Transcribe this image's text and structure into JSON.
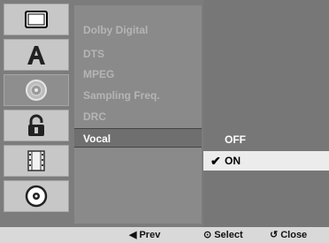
{
  "sidebar": {
    "tiles": [
      {
        "icon": "tv-screen-icon"
      },
      {
        "icon": "font-a-icon"
      },
      {
        "icon": "speaker-icon",
        "selected": true
      },
      {
        "icon": "lock-icon"
      },
      {
        "icon": "film-icon"
      },
      {
        "icon": "disc-icon"
      }
    ]
  },
  "menu": {
    "items": [
      "Dolby Digital",
      "DTS",
      "MPEG",
      "Sampling Freq.",
      "DRC",
      "Vocal"
    ],
    "active_index": 5
  },
  "options": {
    "items": [
      "OFF",
      "ON"
    ],
    "selected_index": 1
  },
  "bottom": {
    "prev": "Prev",
    "select": "Select",
    "close": "Close"
  },
  "colors": {
    "frame": "#7c7c7c",
    "menu_bg": "#8a8a8a",
    "options_bg": "#777777",
    "selected_option": "#ececec"
  }
}
